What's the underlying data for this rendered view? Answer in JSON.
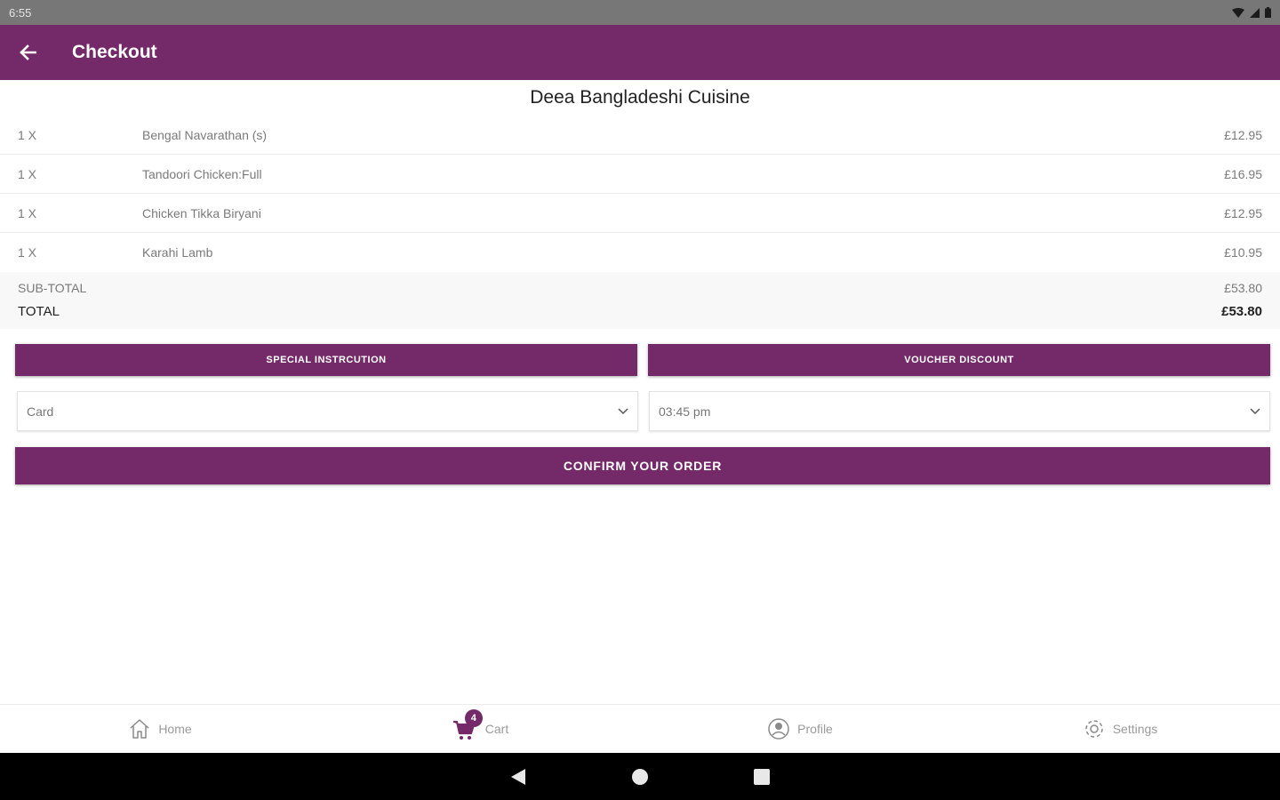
{
  "status_bar": {
    "time": "6:55"
  },
  "app_bar": {
    "title": "Checkout"
  },
  "restaurant": {
    "name": "Deea Bangladeshi Cuisine"
  },
  "items": [
    {
      "qty": "1 X",
      "name": "Bengal Navarathan (s)",
      "price": "£12.95"
    },
    {
      "qty": "1 X",
      "name": "Tandoori Chicken:Full",
      "price": "£16.95"
    },
    {
      "qty": "1 X",
      "name": "Chicken Tikka Biryani",
      "price": "£12.95"
    },
    {
      "qty": "1 X",
      "name": "Karahi Lamb",
      "price": "£10.95"
    }
  ],
  "totals": {
    "subtotal_label": "SUB-TOTAL",
    "subtotal_value": "£53.80",
    "total_label": "TOTAL",
    "total_value": "£53.80"
  },
  "buttons": {
    "special_instruction": "SPECIAL INSTRCUTION",
    "voucher_discount": "VOUCHER DISCOUNT",
    "confirm": "CONFIRM YOUR ORDER"
  },
  "selects": {
    "payment": "Card",
    "time": "03:45 pm"
  },
  "bottom_nav": {
    "home": "Home",
    "cart": "Cart",
    "cart_badge": "4",
    "profile": "Profile",
    "settings": "Settings"
  },
  "colors": {
    "primary": "#742968",
    "status_bar": "#777777"
  }
}
